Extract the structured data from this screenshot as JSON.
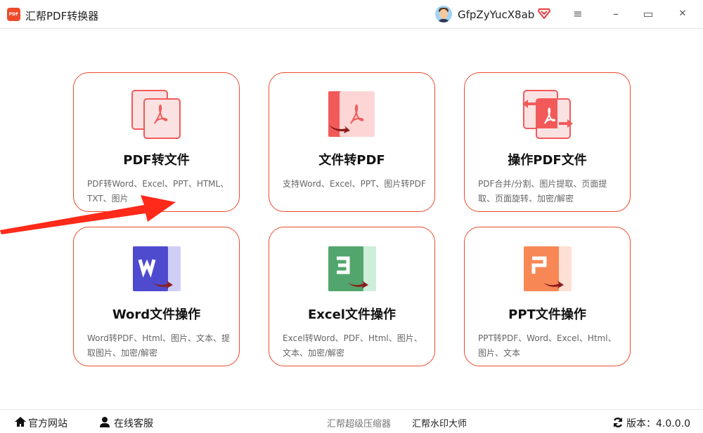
{
  "app": {
    "title": "汇帮PDF转换器",
    "logo_text": "PDF"
  },
  "user": {
    "name": "GfpZyYucX8ab",
    "vip_icon": "vip-diamond-icon"
  },
  "window": {
    "menu_icon": "≡",
    "minimize_icon": "–",
    "maximize_icon": "▭",
    "close_icon": "✕"
  },
  "cards": [
    {
      "title": "PDF转文件",
      "desc": "PDF转Word、Excel、PPT、HTML、TXT、图片",
      "icon": "pdf-to-file-icon",
      "color": "#f25a5a"
    },
    {
      "title": "文件转PDF",
      "desc": "支持Word、Excel、PPT、图片转PDF",
      "icon": "file-to-pdf-icon",
      "color": "#f25a5a"
    },
    {
      "title": "操作PDF文件",
      "desc": "PDF合并/分割、图片提取、页面提取、页面旋转、加密/解密",
      "icon": "operate-pdf-icon",
      "color": "#f25a5a"
    },
    {
      "title": "Word文件操作",
      "desc": "Word转PDF、Html、图片、文本、提取图片、加密/解密",
      "icon": "word-icon",
      "color": "#4e4bcf"
    },
    {
      "title": "Excel文件操作",
      "desc": "Excel转Word、PDF、Html、图片、文本、加密/解密",
      "icon": "excel-icon",
      "color": "#52a56c"
    },
    {
      "title": "PPT文件操作",
      "desc": "PPT转PDF、Word、Excel、Html、图片、文本",
      "icon": "ppt-icon",
      "color": "#f78855"
    }
  ],
  "footer": {
    "website": "官方网站",
    "service": "在线客服",
    "compressor": "汇帮超级压缩器",
    "watermark": "汇帮水印大师",
    "version": "版本：4.0.0.0"
  },
  "colors": {
    "accent": "#ec4a2c",
    "annotation_arrow": "#ff2a1a"
  }
}
